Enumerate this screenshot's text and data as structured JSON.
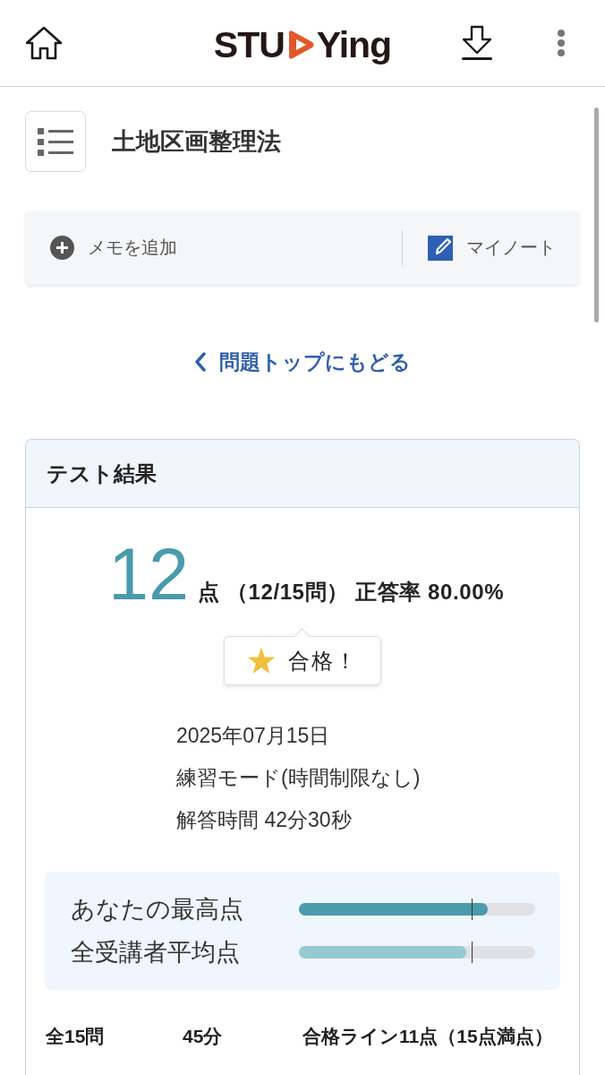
{
  "header": {
    "logo": {
      "before_icon": "STU",
      "after_icon": "Ying"
    }
  },
  "page_title": "土地区画整理法",
  "memo_bar": {
    "add_memo": "メモを追加",
    "my_note": "マイノート"
  },
  "back_link": "問題トップにもどる",
  "result_card": {
    "title": "テスト結果",
    "score": "12",
    "score_detail": "点 （12/15問） 正答率 80.00%",
    "badge": "合格！",
    "details": [
      "2025年07月15日",
      "練習モード(時間制限なし)",
      "解答時間 42分30秒"
    ],
    "comparison": [
      {
        "label": "あなたの最高点",
        "kind": "own",
        "level": 0.8,
        "marker": {
          "level": 0.73
        }
      },
      {
        "label": "全受講者平均点",
        "kind": "average",
        "level": 0.71,
        "marker": {
          "level": 0.73
        }
      }
    ],
    "summary": [
      "全15問",
      "45分",
      "合格ライン11点（15点満点）"
    ]
  }
}
